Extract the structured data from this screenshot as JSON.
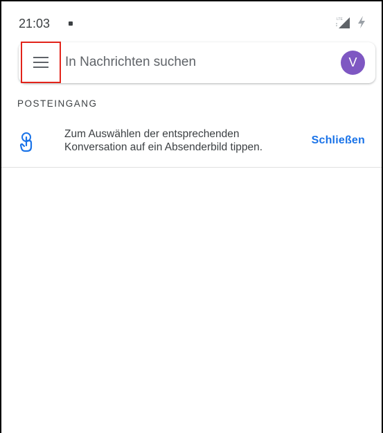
{
  "status_bar": {
    "time": "21:03"
  },
  "search_bar": {
    "placeholder": "In Nachrichten suchen",
    "avatar_initial": "V"
  },
  "inbox": {
    "section_title": "POSTEINGANG"
  },
  "tip": {
    "line1": "Zum Auswählen der entsprechenden",
    "line2": "Konversation auf ein Absenderbild tippen.",
    "close_label": "Schließen"
  },
  "colors": {
    "accent": "#1a73e8",
    "avatar": "#7e57c2",
    "highlight_border": "#e2231a"
  },
  "icons": {
    "menu": "hamburger-menu-icon",
    "tip": "tap-gesture-icon",
    "signal": "lte-signal-icon",
    "battery": "charging-icon"
  }
}
